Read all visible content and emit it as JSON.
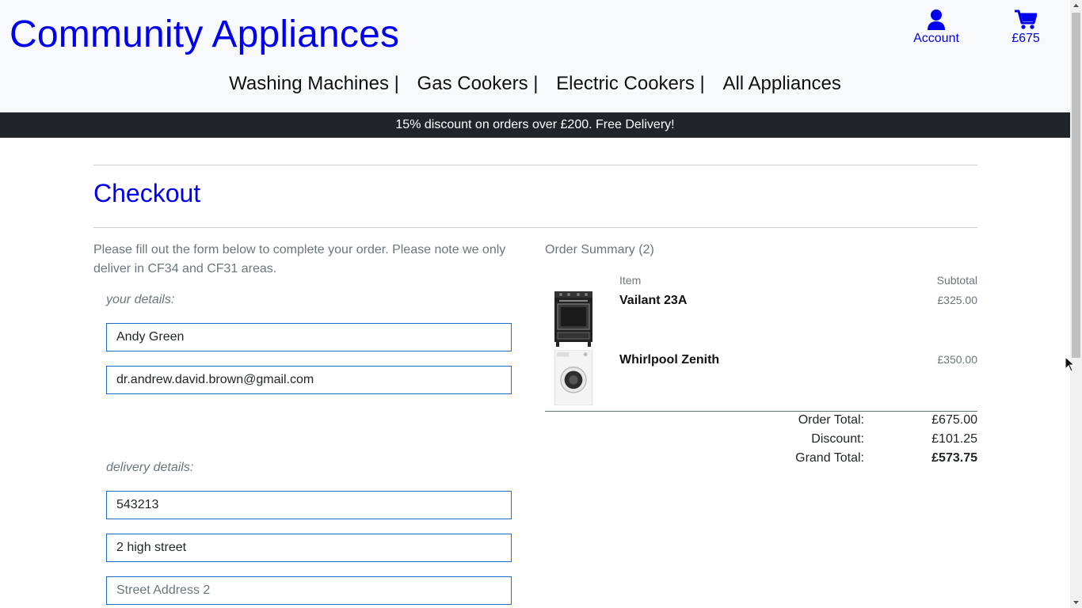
{
  "header": {
    "brand": "Community Appliances",
    "account_label": "Account",
    "cart_label": "£675",
    "account_icon": "user-icon",
    "cart_icon": "cart-icon"
  },
  "nav": {
    "items": [
      {
        "label": "Washing Machines |"
      },
      {
        "label": "Gas Cookers |"
      },
      {
        "label": "Electric Cookers |"
      },
      {
        "label": "All Appliances"
      }
    ]
  },
  "banner": {
    "text": "15% discount on orders over £200. Free Delivery!"
  },
  "checkout": {
    "title": "Checkout",
    "intro": "Please fill out the form below to complete your order. Please note we only deliver in CF34 and CF31 areas.",
    "your_details_label": "your details:",
    "delivery_details_label": "delivery details:",
    "fields": {
      "name": {
        "value": "Andy Green"
      },
      "email": {
        "value": "dr.andrew.david.brown@gmail.com"
      },
      "phone": {
        "value": "543213"
      },
      "street1": {
        "value": "2 high street"
      },
      "street2": {
        "value": "",
        "placeholder": "Street Address 2"
      }
    }
  },
  "summary": {
    "heading": "Order Summary (2)",
    "col_item": "Item",
    "col_subtotal": "Subtotal",
    "items": [
      {
        "name": "Vailant 23A",
        "price": "£325.00",
        "image": "cooker-image"
      },
      {
        "name": "Whirlpool Zenith",
        "price": "£350.00",
        "image": "washing-machine-image"
      }
    ],
    "totals": {
      "order_total_label": "Order Total:",
      "order_total": "£675.00",
      "discount_label": "Discount:",
      "discount": "£101.25",
      "grand_total_label": "Grand Total:",
      "grand_total": "£573.75"
    }
  },
  "colors": {
    "link": "#0000ee",
    "banner_bg": "#212529",
    "header_bg": "#f8f9fa",
    "field_border": "#1b6fc8"
  }
}
